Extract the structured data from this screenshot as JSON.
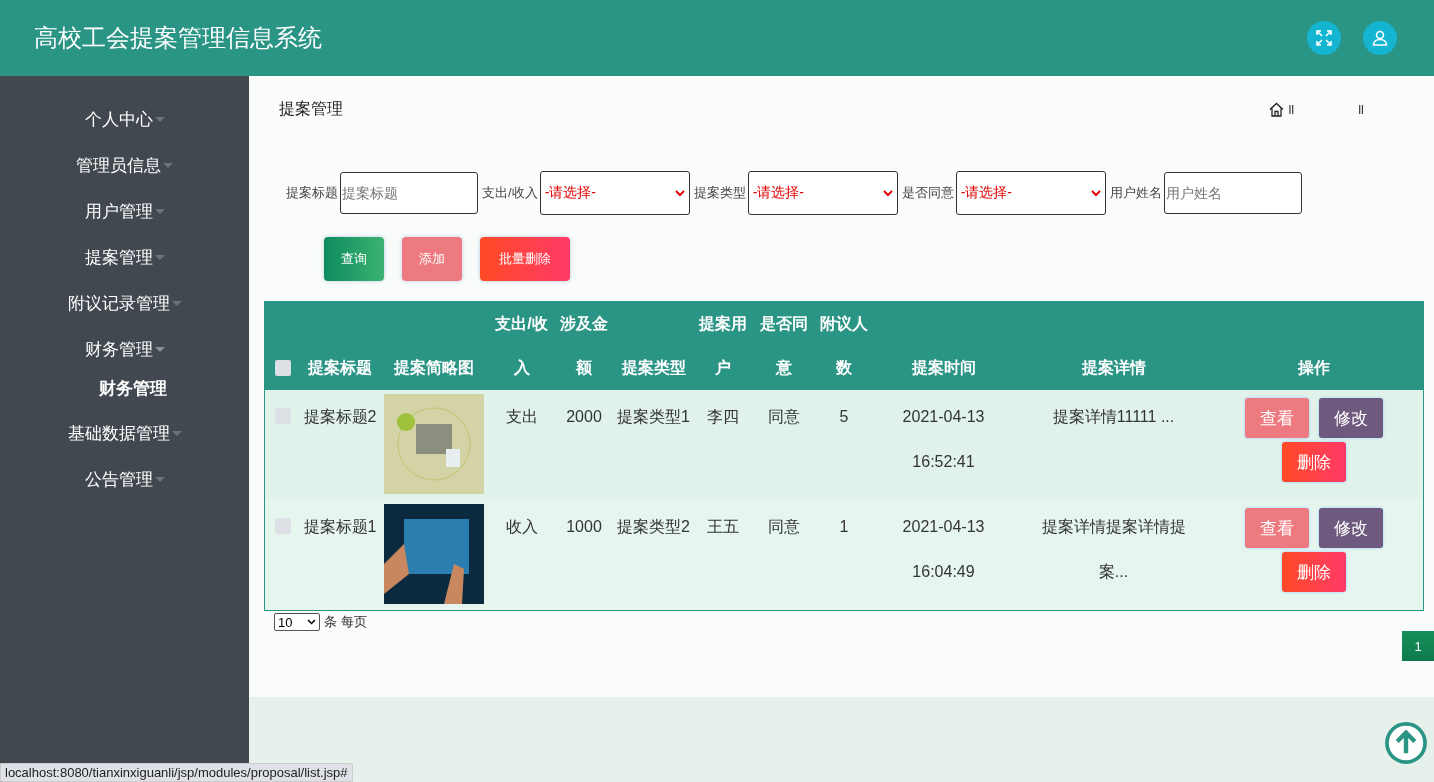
{
  "header": {
    "title": "高校工会提案管理信息系统"
  },
  "sidebar": {
    "items": [
      {
        "label": "个人中心",
        "expanded": false
      },
      {
        "label": "管理员信息",
        "expanded": false
      },
      {
        "label": "用户管理",
        "expanded": false
      },
      {
        "label": "提案管理",
        "expanded": false
      },
      {
        "label": "附议记录管理",
        "expanded": false
      },
      {
        "label": "财务管理",
        "expanded": true,
        "children": [
          {
            "label": "财务管理"
          }
        ]
      },
      {
        "label": "基础数据管理",
        "expanded": false
      },
      {
        "label": "公告管理",
        "expanded": false
      }
    ]
  },
  "page_title": "提案管理",
  "breadcrumb": [
    "ll",
    "ll"
  ],
  "filters": [
    {
      "kind": "input",
      "label": "提案标题",
      "placeholder": "提案标题"
    },
    {
      "kind": "select",
      "label": "支出/收入",
      "value": "-请选择-"
    },
    {
      "kind": "select",
      "label": "提案类型",
      "value": "-请选择-"
    },
    {
      "kind": "select",
      "label": "是否同意",
      "value": "-请选择-"
    },
    {
      "kind": "input",
      "label": "用户姓名",
      "placeholder": "用户姓名"
    }
  ],
  "actions": [
    {
      "kind": "search",
      "label": "查询"
    },
    {
      "kind": "add",
      "label": "添加"
    },
    {
      "kind": "delete",
      "label": "批量删除"
    }
  ],
  "table": {
    "select_all_checked": false,
    "columns": [
      "提案标题",
      "提案简略图",
      "支出/收入",
      "涉及金额",
      "提案类型",
      "提案用户",
      "是否同意",
      "附议人数",
      "提案时间",
      "提案详情",
      "操作"
    ],
    "rows": [
      {
        "checked": false,
        "title": "提案标题2",
        "inout": "支出",
        "amount": "2000",
        "type": "提案类型1",
        "user": "李四",
        "agree": "同意",
        "votes": "5",
        "time": "2021-04-13 16:52:41",
        "detail": "提案详情11111 ...",
        "buttons": [
          {
            "kind": "view",
            "label": "查看"
          },
          {
            "kind": "edit",
            "label": "修改"
          },
          {
            "kind": "delete",
            "label": "删除"
          }
        ]
      },
      {
        "checked": false,
        "title": "提案标题1",
        "inout": "收入",
        "amount": "1000",
        "type": "提案类型2",
        "user": "王五",
        "agree": "同意",
        "votes": "1",
        "time": "2021-04-13 16:04:49",
        "detail": "提案详情提案详情提案...",
        "buttons": [
          {
            "kind": "view",
            "label": "查看"
          },
          {
            "kind": "edit",
            "label": "修改"
          },
          {
            "kind": "delete",
            "label": "删除"
          }
        ]
      }
    ]
  },
  "pagination": {
    "page_size": "10",
    "page_size_label": "条 每页",
    "pages": [
      {
        "label": "1",
        "selected": true
      }
    ]
  },
  "status_bar": "localhost:8080/tianxinxiguanli/jsp/modules/proposal/list.jsp#"
}
